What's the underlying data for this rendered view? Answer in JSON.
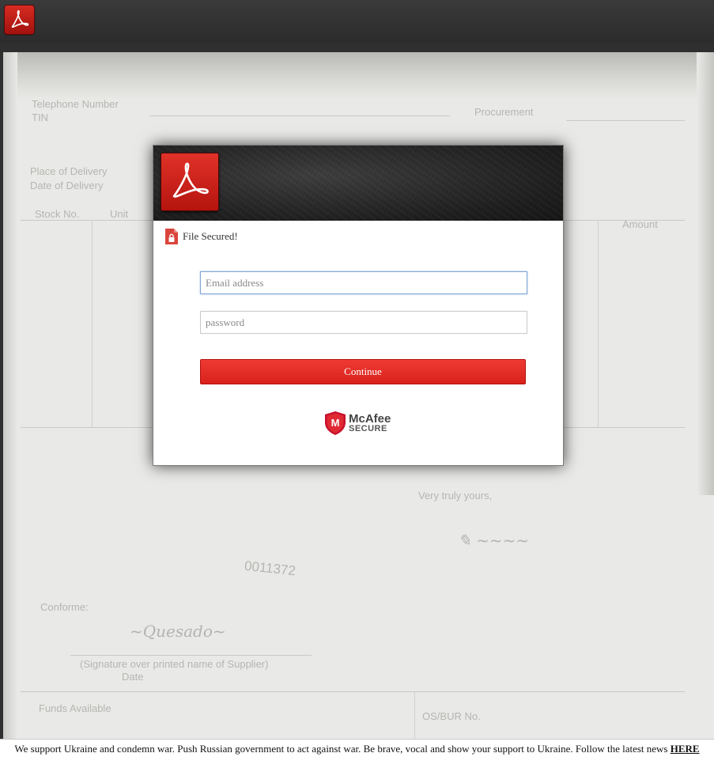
{
  "app": {
    "logo_icon": "acrobat-pdf-icon",
    "accent_color": "#d21f18"
  },
  "document_background": {
    "texts": [
      "Telephone Number",
      "TIN",
      "Place of Delivery",
      "Date of Delivery",
      "Stock No.",
      "Unit",
      "Procurement",
      "Amount",
      "Very truly yours,",
      "0011372",
      "Conforme:",
      "(Signature over printed name of Supplier)",
      "Date",
      "Funds Available",
      "OS/BUR No."
    ]
  },
  "modal": {
    "header_logo_icon": "acrobat-pdf-icon",
    "secured_icon": "locked-file-icon",
    "secured_label": "File Secured!",
    "email_placeholder": "Email address",
    "password_placeholder": "password",
    "continue_label": "Continue",
    "badge": {
      "icon": "mcafee-shield-icon",
      "name": "McAfee",
      "sub": "SECURE"
    }
  },
  "banner": {
    "text": "We support Ukraine and condemn war. Push Russian government to act against war. Be brave, vocal and show your support to Ukraine. Follow the latest news",
    "link_label": "HERE"
  }
}
